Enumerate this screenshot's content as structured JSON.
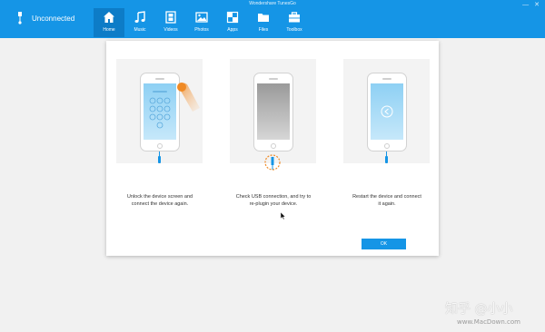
{
  "window": {
    "title": "Wondershare TunesGo"
  },
  "device": {
    "status": "Unconnected"
  },
  "nav": {
    "items": [
      {
        "label": "Home",
        "icon": "home-icon",
        "active": true
      },
      {
        "label": "Music",
        "icon": "music-icon",
        "active": false
      },
      {
        "label": "Videos",
        "icon": "video-icon",
        "active": false
      },
      {
        "label": "Photos",
        "icon": "photo-icon",
        "active": false
      },
      {
        "label": "Apps",
        "icon": "apps-icon",
        "active": false
      },
      {
        "label": "Files",
        "icon": "folder-icon",
        "active": false
      },
      {
        "label": "Toolbox",
        "icon": "toolbox-icon",
        "active": false
      }
    ]
  },
  "dialog": {
    "steps": [
      {
        "line1": "Unlock the device screen and",
        "line2": "connect the device again."
      },
      {
        "line1": "Check USB connection, and try to",
        "line2": "re-plugin your device."
      },
      {
        "line1": "Restart the device and connect",
        "line2": "it again."
      }
    ],
    "ok_label": "OK"
  },
  "watermark": {
    "line1": "知乎 @小小",
    "line2": "www.MacDown.com"
  },
  "colors": {
    "accent": "#1595e6",
    "accent_dark": "#0d7cc7",
    "warning": "#f08a24"
  }
}
